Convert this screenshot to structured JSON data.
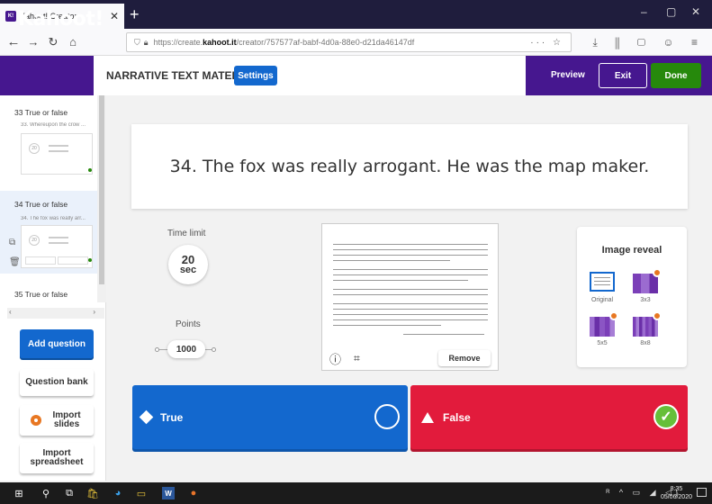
{
  "browser": {
    "tab_title": "Kahoot! Creator",
    "tab_favicon": "K!",
    "url_prefix": "https://create.",
    "url_domain": "kahoot.it",
    "url_path": "/creator/757577af-babf-4d0a-88e0-d21da46147df"
  },
  "header": {
    "logo": "Kahoot!",
    "kahoot_title": "NARRATIVE TEXT MATERIAL",
    "settings_label": "Settings",
    "preview_label": "Preview",
    "exit_label": "Exit",
    "done_label": "Done"
  },
  "sidebar": {
    "items": [
      {
        "title": "33 True or false",
        "subtitle": "33. Whereupon the crow ...",
        "timer": "20"
      },
      {
        "title": "34 True or false",
        "subtitle": "34. The fox was really arr...",
        "timer": "20"
      },
      {
        "title": "35 True or false"
      }
    ],
    "add_question_label": "Add question",
    "question_bank_label": "Question bank",
    "import_slides_label": "Import slides",
    "import_spreadsheet_label": "Import spreadsheet"
  },
  "question": {
    "text": "34. The fox was really arrogant. He was the map maker."
  },
  "settings_panel": {
    "time_limit_label": "Time limit",
    "time_value": "20",
    "time_unit": "sec",
    "points_label": "Points",
    "points_value": "1000"
  },
  "media": {
    "remove_label": "Remove",
    "info_icon": "info-icon",
    "crop_icon": "crop-icon"
  },
  "image_reveal": {
    "title": "Image reveal",
    "options": [
      "Original",
      "3x3",
      "5x5",
      "8x8"
    ]
  },
  "answers": [
    {
      "text": "True",
      "color": "#1368ce",
      "correct": false
    },
    {
      "text": "False",
      "color": "#e21b3c",
      "correct": true
    }
  ],
  "taskbar": {
    "time": "8:35",
    "date": "05/06/2020"
  },
  "colors": {
    "brand_purple": "#46178f",
    "blue": "#1368ce",
    "green": "#26890c",
    "red": "#e21b3c"
  }
}
